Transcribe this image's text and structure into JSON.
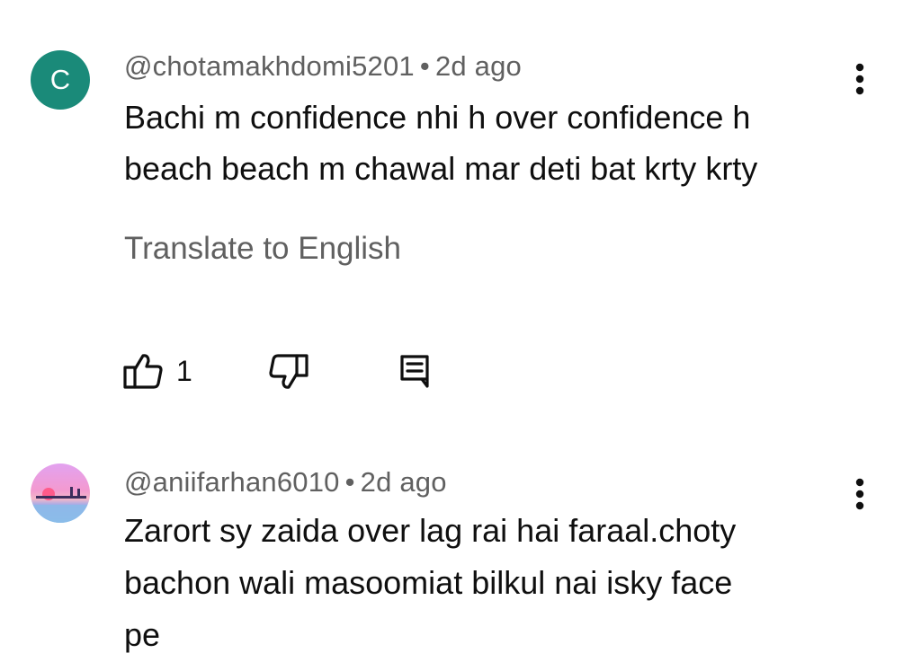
{
  "comments": [
    {
      "avatar_letter": "C",
      "avatar_color": "#1a8a79",
      "username": "@chotamakhdomi5201",
      "separator": "•",
      "time": "2d ago",
      "text_lines": [
        "Bachi m confidence nhi h over confidence h",
        "beach beach m chawal mar deti bat krty krty"
      ],
      "translate_label": "Translate to English",
      "like_count": "1",
      "icons": {
        "more": "more-vertical-icon",
        "like": "thumbs-up-icon",
        "dislike": "thumbs-down-icon",
        "reply": "reply-icon"
      }
    },
    {
      "avatar_type": "image",
      "username": "@aniifarhan6010",
      "separator": "•",
      "time": "2d ago",
      "text_lines": [
        "Zarort sy zaida over lag rai hai faraal.choty",
        "bachon wali masoomiat bilkul nai isky face",
        "pe"
      ],
      "icons": {
        "more": "more-vertical-icon"
      }
    }
  ]
}
